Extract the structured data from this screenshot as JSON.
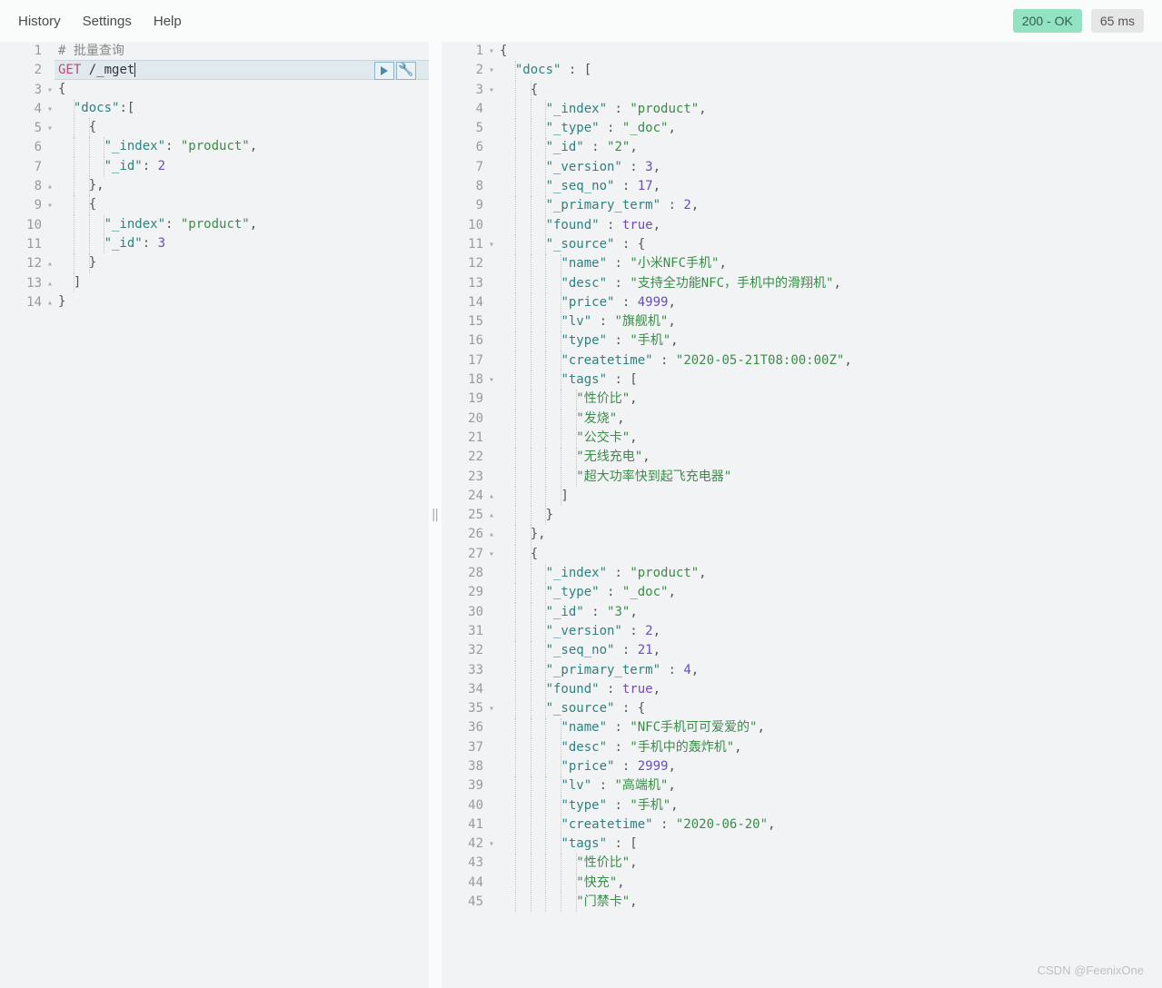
{
  "menu": {
    "history": "History",
    "settings": "Settings",
    "help": "Help"
  },
  "status": {
    "code": "200 - OK",
    "time": "65 ms"
  },
  "watermark": "CSDN @FeenixOne",
  "request": {
    "lines": [
      {
        "n": 1,
        "fold": "",
        "tokens": [
          [
            "comment",
            "# 批量查询"
          ]
        ]
      },
      {
        "n": 2,
        "fold": "",
        "active": true,
        "actions": true,
        "tokens": [
          [
            "method",
            "GET"
          ],
          [
            "punc",
            " "
          ],
          [
            "path",
            "/_mget"
          ],
          [
            "cursor",
            ""
          ]
        ]
      },
      {
        "n": 3,
        "fold": "▾",
        "tokens": [
          [
            "punc",
            "{"
          ]
        ]
      },
      {
        "n": 4,
        "fold": "▾",
        "tokens": [
          [
            "punc",
            "  "
          ],
          [
            "key",
            "\"docs\""
          ],
          [
            "punc",
            ":["
          ]
        ]
      },
      {
        "n": 5,
        "fold": "▾",
        "tokens": [
          [
            "punc",
            "    {"
          ]
        ]
      },
      {
        "n": 6,
        "fold": "",
        "tokens": [
          [
            "punc",
            "      "
          ],
          [
            "key",
            "\"_index\""
          ],
          [
            "punc",
            ": "
          ],
          [
            "str",
            "\"product\""
          ],
          [
            "punc",
            ","
          ]
        ]
      },
      {
        "n": 7,
        "fold": "",
        "tokens": [
          [
            "punc",
            "      "
          ],
          [
            "key",
            "\"_id\""
          ],
          [
            "punc",
            ": "
          ],
          [
            "num",
            "2"
          ]
        ]
      },
      {
        "n": 8,
        "fold": "▴",
        "tokens": [
          [
            "punc",
            "    },"
          ]
        ]
      },
      {
        "n": 9,
        "fold": "▾",
        "tokens": [
          [
            "punc",
            "    {"
          ]
        ]
      },
      {
        "n": 10,
        "fold": "",
        "tokens": [
          [
            "punc",
            "      "
          ],
          [
            "key",
            "\"_index\""
          ],
          [
            "punc",
            ": "
          ],
          [
            "str",
            "\"product\""
          ],
          [
            "punc",
            ","
          ]
        ]
      },
      {
        "n": 11,
        "fold": "",
        "tokens": [
          [
            "punc",
            "      "
          ],
          [
            "key",
            "\"_id\""
          ],
          [
            "punc",
            ": "
          ],
          [
            "num",
            "3"
          ]
        ]
      },
      {
        "n": 12,
        "fold": "▴",
        "tokens": [
          [
            "punc",
            "    }"
          ]
        ]
      },
      {
        "n": 13,
        "fold": "▴",
        "tokens": [
          [
            "punc",
            "  ]"
          ]
        ]
      },
      {
        "n": 14,
        "fold": "▴",
        "tokens": [
          [
            "punc",
            "}"
          ]
        ]
      }
    ]
  },
  "response": {
    "lines": [
      {
        "n": 1,
        "fold": "▾",
        "tokens": [
          [
            "punc",
            "{"
          ]
        ]
      },
      {
        "n": 2,
        "fold": "▾",
        "tokens": [
          [
            "punc",
            "  "
          ],
          [
            "key",
            "\"docs\""
          ],
          [
            "punc",
            " : ["
          ]
        ]
      },
      {
        "n": 3,
        "fold": "▾",
        "tokens": [
          [
            "punc",
            "    {"
          ]
        ]
      },
      {
        "n": 4,
        "fold": "",
        "tokens": [
          [
            "punc",
            "      "
          ],
          [
            "key",
            "\"_index\""
          ],
          [
            "punc",
            " : "
          ],
          [
            "str",
            "\"product\""
          ],
          [
            "punc",
            ","
          ]
        ]
      },
      {
        "n": 5,
        "fold": "",
        "tokens": [
          [
            "punc",
            "      "
          ],
          [
            "key",
            "\"_type\""
          ],
          [
            "punc",
            " : "
          ],
          [
            "str",
            "\"_doc\""
          ],
          [
            "punc",
            ","
          ]
        ]
      },
      {
        "n": 6,
        "fold": "",
        "tokens": [
          [
            "punc",
            "      "
          ],
          [
            "key",
            "\"_id\""
          ],
          [
            "punc",
            " : "
          ],
          [
            "str",
            "\"2\""
          ],
          [
            "punc",
            ","
          ]
        ]
      },
      {
        "n": 7,
        "fold": "",
        "tokens": [
          [
            "punc",
            "      "
          ],
          [
            "key",
            "\"_version\""
          ],
          [
            "punc",
            " : "
          ],
          [
            "num",
            "3"
          ],
          [
            "punc",
            ","
          ]
        ]
      },
      {
        "n": 8,
        "fold": "",
        "tokens": [
          [
            "punc",
            "      "
          ],
          [
            "key",
            "\"_seq_no\""
          ],
          [
            "punc",
            " : "
          ],
          [
            "num",
            "17"
          ],
          [
            "punc",
            ","
          ]
        ]
      },
      {
        "n": 9,
        "fold": "",
        "tokens": [
          [
            "punc",
            "      "
          ],
          [
            "key",
            "\"_primary_term\""
          ],
          [
            "punc",
            " : "
          ],
          [
            "num",
            "2"
          ],
          [
            "punc",
            ","
          ]
        ]
      },
      {
        "n": 10,
        "fold": "",
        "tokens": [
          [
            "punc",
            "      "
          ],
          [
            "key",
            "\"found\""
          ],
          [
            "punc",
            " : "
          ],
          [
            "bool",
            "true"
          ],
          [
            "punc",
            ","
          ]
        ]
      },
      {
        "n": 11,
        "fold": "▾",
        "tokens": [
          [
            "punc",
            "      "
          ],
          [
            "key",
            "\"_source\""
          ],
          [
            "punc",
            " : {"
          ]
        ]
      },
      {
        "n": 12,
        "fold": "",
        "tokens": [
          [
            "punc",
            "        "
          ],
          [
            "key",
            "\"name\""
          ],
          [
            "punc",
            " : "
          ],
          [
            "str",
            "\"小米NFC手机\""
          ],
          [
            "punc",
            ","
          ]
        ]
      },
      {
        "n": 13,
        "fold": "",
        "tokens": [
          [
            "punc",
            "        "
          ],
          [
            "key",
            "\"desc\""
          ],
          [
            "punc",
            " : "
          ],
          [
            "str",
            "\"支持全功能NFC，手机中的滑翔机\""
          ],
          [
            "punc",
            ","
          ]
        ]
      },
      {
        "n": 14,
        "fold": "",
        "tokens": [
          [
            "punc",
            "        "
          ],
          [
            "key",
            "\"price\""
          ],
          [
            "punc",
            " : "
          ],
          [
            "num",
            "4999"
          ],
          [
            "punc",
            ","
          ]
        ]
      },
      {
        "n": 15,
        "fold": "",
        "tokens": [
          [
            "punc",
            "        "
          ],
          [
            "key",
            "\"lv\""
          ],
          [
            "punc",
            " : "
          ],
          [
            "str",
            "\"旗舰机\""
          ],
          [
            "punc",
            ","
          ]
        ]
      },
      {
        "n": 16,
        "fold": "",
        "tokens": [
          [
            "punc",
            "        "
          ],
          [
            "key",
            "\"type\""
          ],
          [
            "punc",
            " : "
          ],
          [
            "str",
            "\"手机\""
          ],
          [
            "punc",
            ","
          ]
        ]
      },
      {
        "n": 17,
        "fold": "",
        "tokens": [
          [
            "punc",
            "        "
          ],
          [
            "key",
            "\"createtime\""
          ],
          [
            "punc",
            " : "
          ],
          [
            "str",
            "\"2020-05-21T08:00:00Z\""
          ],
          [
            "punc",
            ","
          ]
        ]
      },
      {
        "n": 18,
        "fold": "▾",
        "tokens": [
          [
            "punc",
            "        "
          ],
          [
            "key",
            "\"tags\""
          ],
          [
            "punc",
            " : ["
          ]
        ]
      },
      {
        "n": 19,
        "fold": "",
        "tokens": [
          [
            "punc",
            "          "
          ],
          [
            "str",
            "\"性价比\""
          ],
          [
            "punc",
            ","
          ]
        ]
      },
      {
        "n": 20,
        "fold": "",
        "tokens": [
          [
            "punc",
            "          "
          ],
          [
            "str",
            "\"发烧\""
          ],
          [
            "punc",
            ","
          ]
        ]
      },
      {
        "n": 21,
        "fold": "",
        "tokens": [
          [
            "punc",
            "          "
          ],
          [
            "str",
            "\"公交卡\""
          ],
          [
            "punc",
            ","
          ]
        ]
      },
      {
        "n": 22,
        "fold": "",
        "tokens": [
          [
            "punc",
            "          "
          ],
          [
            "str",
            "\"无线充电\""
          ],
          [
            "punc",
            ","
          ]
        ]
      },
      {
        "n": 23,
        "fold": "",
        "tokens": [
          [
            "punc",
            "          "
          ],
          [
            "str",
            "\"超大功率快到起飞充电器\""
          ]
        ]
      },
      {
        "n": 24,
        "fold": "▴",
        "tokens": [
          [
            "punc",
            "        ]"
          ]
        ]
      },
      {
        "n": 25,
        "fold": "▴",
        "tokens": [
          [
            "punc",
            "      }"
          ]
        ]
      },
      {
        "n": 26,
        "fold": "▴",
        "tokens": [
          [
            "punc",
            "    },"
          ]
        ]
      },
      {
        "n": 27,
        "fold": "▾",
        "tokens": [
          [
            "punc",
            "    {"
          ]
        ]
      },
      {
        "n": 28,
        "fold": "",
        "tokens": [
          [
            "punc",
            "      "
          ],
          [
            "key",
            "\"_index\""
          ],
          [
            "punc",
            " : "
          ],
          [
            "str",
            "\"product\""
          ],
          [
            "punc",
            ","
          ]
        ]
      },
      {
        "n": 29,
        "fold": "",
        "tokens": [
          [
            "punc",
            "      "
          ],
          [
            "key",
            "\"_type\""
          ],
          [
            "punc",
            " : "
          ],
          [
            "str",
            "\"_doc\""
          ],
          [
            "punc",
            ","
          ]
        ]
      },
      {
        "n": 30,
        "fold": "",
        "tokens": [
          [
            "punc",
            "      "
          ],
          [
            "key",
            "\"_id\""
          ],
          [
            "punc",
            " : "
          ],
          [
            "str",
            "\"3\""
          ],
          [
            "punc",
            ","
          ]
        ]
      },
      {
        "n": 31,
        "fold": "",
        "tokens": [
          [
            "punc",
            "      "
          ],
          [
            "key",
            "\"_version\""
          ],
          [
            "punc",
            " : "
          ],
          [
            "num",
            "2"
          ],
          [
            "punc",
            ","
          ]
        ]
      },
      {
        "n": 32,
        "fold": "",
        "tokens": [
          [
            "punc",
            "      "
          ],
          [
            "key",
            "\"_seq_no\""
          ],
          [
            "punc",
            " : "
          ],
          [
            "num",
            "21"
          ],
          [
            "punc",
            ","
          ]
        ]
      },
      {
        "n": 33,
        "fold": "",
        "tokens": [
          [
            "punc",
            "      "
          ],
          [
            "key",
            "\"_primary_term\""
          ],
          [
            "punc",
            " : "
          ],
          [
            "num",
            "4"
          ],
          [
            "punc",
            ","
          ]
        ]
      },
      {
        "n": 34,
        "fold": "",
        "tokens": [
          [
            "punc",
            "      "
          ],
          [
            "key",
            "\"found\""
          ],
          [
            "punc",
            " : "
          ],
          [
            "bool",
            "true"
          ],
          [
            "punc",
            ","
          ]
        ]
      },
      {
        "n": 35,
        "fold": "▾",
        "tokens": [
          [
            "punc",
            "      "
          ],
          [
            "key",
            "\"_source\""
          ],
          [
            "punc",
            " : {"
          ]
        ]
      },
      {
        "n": 36,
        "fold": "",
        "tokens": [
          [
            "punc",
            "        "
          ],
          [
            "key",
            "\"name\""
          ],
          [
            "punc",
            " : "
          ],
          [
            "str",
            "\"NFC手机可可爱爱的\""
          ],
          [
            "punc",
            ","
          ]
        ]
      },
      {
        "n": 37,
        "fold": "",
        "tokens": [
          [
            "punc",
            "        "
          ],
          [
            "key",
            "\"desc\""
          ],
          [
            "punc",
            " : "
          ],
          [
            "str",
            "\"手机中的轰炸机\""
          ],
          [
            "punc",
            ","
          ]
        ]
      },
      {
        "n": 38,
        "fold": "",
        "tokens": [
          [
            "punc",
            "        "
          ],
          [
            "key",
            "\"price\""
          ],
          [
            "punc",
            " : "
          ],
          [
            "num",
            "2999"
          ],
          [
            "punc",
            ","
          ]
        ]
      },
      {
        "n": 39,
        "fold": "",
        "tokens": [
          [
            "punc",
            "        "
          ],
          [
            "key",
            "\"lv\""
          ],
          [
            "punc",
            " : "
          ],
          [
            "str",
            "\"高端机\""
          ],
          [
            "punc",
            ","
          ]
        ]
      },
      {
        "n": 40,
        "fold": "",
        "tokens": [
          [
            "punc",
            "        "
          ],
          [
            "key",
            "\"type\""
          ],
          [
            "punc",
            " : "
          ],
          [
            "str",
            "\"手机\""
          ],
          [
            "punc",
            ","
          ]
        ]
      },
      {
        "n": 41,
        "fold": "",
        "tokens": [
          [
            "punc",
            "        "
          ],
          [
            "key",
            "\"createtime\""
          ],
          [
            "punc",
            " : "
          ],
          [
            "str",
            "\"2020-06-20\""
          ],
          [
            "punc",
            ","
          ]
        ]
      },
      {
        "n": 42,
        "fold": "▾",
        "tokens": [
          [
            "punc",
            "        "
          ],
          [
            "key",
            "\"tags\""
          ],
          [
            "punc",
            " : ["
          ]
        ]
      },
      {
        "n": 43,
        "fold": "",
        "tokens": [
          [
            "punc",
            "          "
          ],
          [
            "str",
            "\"性价比\""
          ],
          [
            "punc",
            ","
          ]
        ]
      },
      {
        "n": 44,
        "fold": "",
        "tokens": [
          [
            "punc",
            "          "
          ],
          [
            "str",
            "\"快充\""
          ],
          [
            "punc",
            ","
          ]
        ]
      },
      {
        "n": 45,
        "fold": "",
        "tokens": [
          [
            "punc",
            "          "
          ],
          [
            "str",
            "\"门禁卡\""
          ],
          [
            "punc",
            ","
          ]
        ]
      }
    ]
  }
}
